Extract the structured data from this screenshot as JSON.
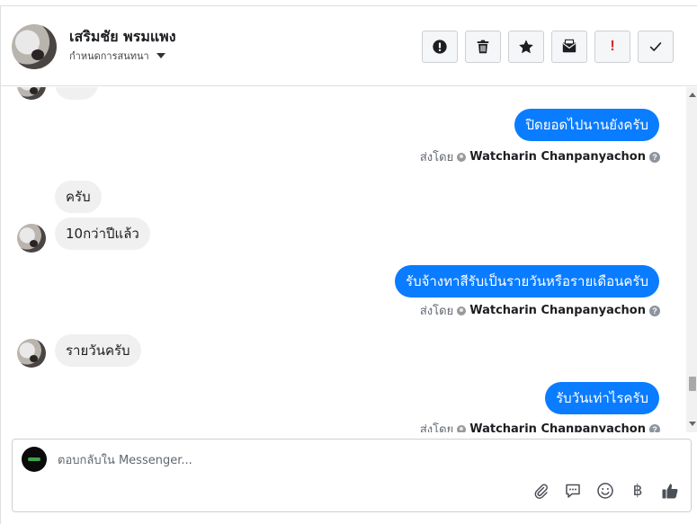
{
  "header": {
    "contact_name": "เสริมชัย พรมแพง",
    "assign_label": "กำหนดการสนทนา",
    "toolbar": [
      {
        "name": "report-icon",
        "label": ""
      },
      {
        "name": "trash-icon",
        "label": ""
      },
      {
        "name": "star-icon",
        "label": ""
      },
      {
        "name": "mark-unread-icon",
        "label": ""
      },
      {
        "name": "follow-up-icon",
        "label": "!"
      },
      {
        "name": "checkmark-icon",
        "label": ""
      }
    ]
  },
  "thread": {
    "messages": [
      {
        "dir": "out",
        "text": "ปิดยอดไปนานยังครับ"
      },
      {
        "dir": "in",
        "text": "ครับ"
      },
      {
        "dir": "in",
        "text": "10กว่าปีแล้ว"
      },
      {
        "dir": "out",
        "text": "รับจ้างทาสีรับเป็นรายวันหรือรายเดือนครับ"
      },
      {
        "dir": "in",
        "text": "รายวันครับ"
      },
      {
        "dir": "out",
        "text": "รับวันเท่าไรครับ"
      }
    ],
    "sent_by_label": "ส่งโดย",
    "sender_name": "Watcharin Chanpanyachon",
    "help_glyph": "?"
  },
  "composer": {
    "placeholder": "ตอบกลับใน Messenger...",
    "baht_glyph": "฿",
    "tools": [
      "paperclip-icon",
      "saved-reply-icon",
      "emoji-icon",
      "baht-icon",
      "thumbs-up-icon"
    ]
  },
  "colors": {
    "outgoing_bubble": "#0a7cff",
    "incoming_bubble": "#f0f0f0",
    "follow_up": "#e02020"
  }
}
